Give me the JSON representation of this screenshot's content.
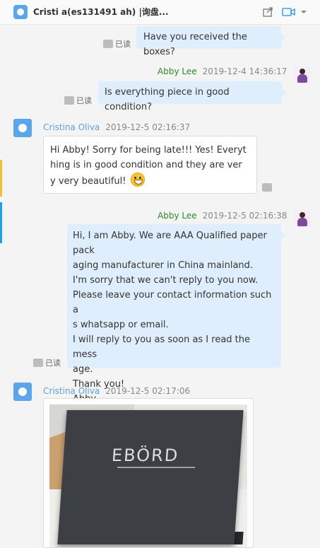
{
  "header": {
    "title": "Cristi            a(es131491           ah) |询盘..."
  },
  "messages": [
    {
      "direction": "out",
      "text": "Have you received the boxes?",
      "read": "已读"
    },
    {
      "direction": "out",
      "sender": "Abby Lee",
      "time": "2019-12-4 14:36:17",
      "text": "Is everything piece in good condition?",
      "read": "已读"
    },
    {
      "direction": "in",
      "sender": "Cristina Oliva",
      "time": "2019-12-5 02:16:37",
      "lines": [
        "Hi Abby! Sorry for being late!!! Yes! Everyt",
        "hing is in good condition and they are ver",
        "y very beautiful!"
      ]
    },
    {
      "direction": "out",
      "sender": "Abby Lee",
      "time": "2019-12-5 02:16:38",
      "lines": [
        "Hi, I am Abby. We are AAA Qualified paper pack",
        "aging manufacturer in China mainland.",
        "I'm sorry that we can't reply to you now.",
        "Please leave your contact information such a",
        "s whatsapp or email.",
        "I will reply to you as soon as I read the mess",
        "age.",
        "Thank you!",
        "Abby"
      ],
      "read": "已读"
    },
    {
      "direction": "in",
      "sender": "Cristina Oliva",
      "time": "2019-12-5 02:17:06",
      "image_text": "EBÖRD"
    }
  ],
  "colors": {
    "outgoing_bubble": "#dfeefc",
    "sender_out": "#2a8a2a",
    "sender_in": "#5fa0d8"
  },
  "icons": [
    "share-icon",
    "video-call-icon",
    "chevron-down-icon"
  ]
}
